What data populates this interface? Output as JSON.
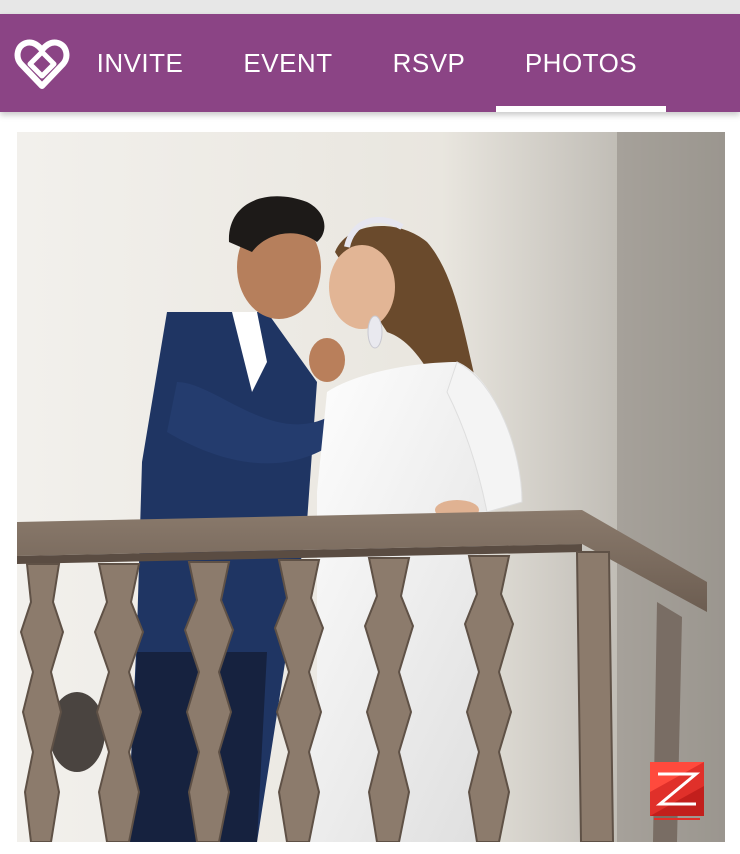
{
  "nav": {
    "logo_icon": "heart-diamond-logo-icon",
    "tabs": [
      {
        "label": "INVITE"
      },
      {
        "label": "EVENT"
      },
      {
        "label": "RSVP"
      },
      {
        "label": "PHOTOS",
        "active": true
      }
    ],
    "background_color": "#8b4485"
  },
  "main": {
    "photo": {
      "watermark_icon": "photographer-watermark-icon"
    }
  }
}
